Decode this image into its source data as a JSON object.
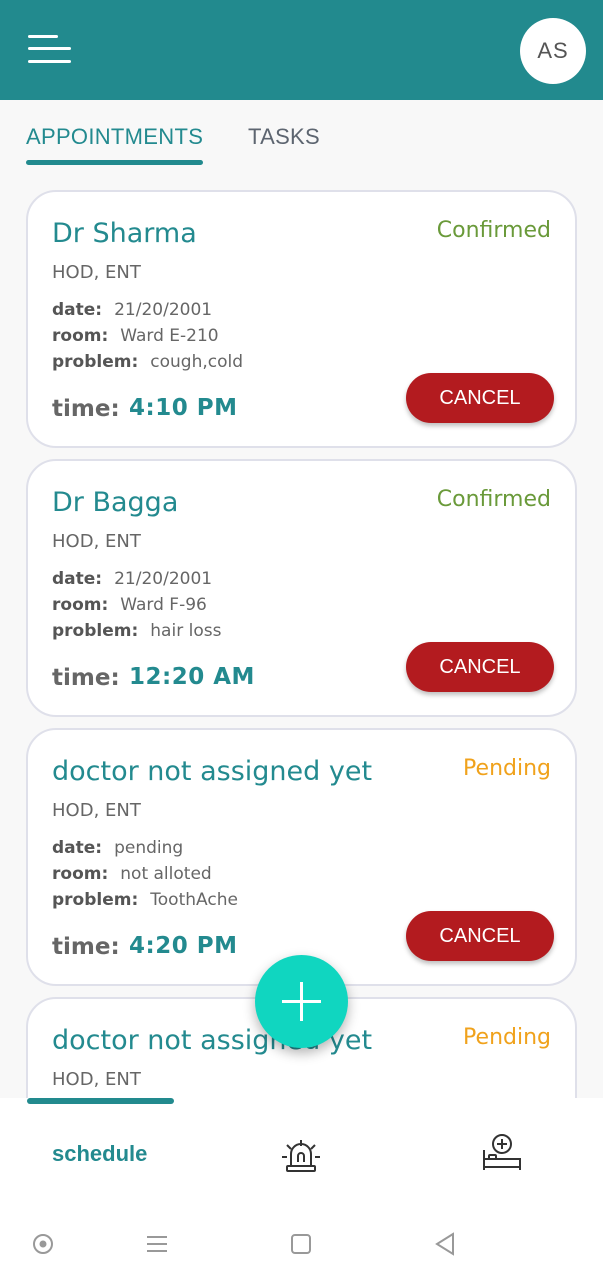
{
  "header": {
    "avatar_initials": "AS",
    "menu_icon": "hamburger-menu-icon"
  },
  "tabs": [
    {
      "label": "APPOINTMENTS",
      "active": true
    },
    {
      "label": "TASKS",
      "active": false
    }
  ],
  "appointments": [
    {
      "doctor": "Dr Sharma",
      "status": "Confirmed",
      "status_color": "#6a9a3a",
      "dept": "HOD, ENT",
      "date_label": "date:",
      "date": "21/20/2001",
      "room_label": "room:",
      "room": "Ward E-210",
      "problem_label": "problem:",
      "problem": "cough,cold",
      "time_label": "time:",
      "time": "4:10 PM",
      "cancel_label": "CANCEL"
    },
    {
      "doctor": "Dr Bagga",
      "status": "Confirmed",
      "status_color": "#6a9a3a",
      "dept": "HOD, ENT",
      "date_label": "date:",
      "date": "21/20/2001",
      "room_label": "room:",
      "room": "Ward F-96",
      "problem_label": "problem:",
      "problem": "hair loss",
      "time_label": "time:",
      "time": "12:20 AM",
      "cancel_label": "CANCEL"
    },
    {
      "doctor": "doctor not assigned yet",
      "status": "Pending",
      "status_color": "#f0a21c",
      "dept": "HOD, ENT",
      "date_label": "date:",
      "date": "pending",
      "room_label": "room:",
      "room": "not alloted",
      "problem_label": "problem:",
      "problem": "ToothAche",
      "time_label": "time:",
      "time": "4:20 PM",
      "cancel_label": "CANCEL"
    },
    {
      "doctor": "doctor not assigned yet",
      "status": "Pending",
      "status_color": "#f0a21c",
      "dept": "HOD, ENT"
    }
  ],
  "fab": {
    "icon": "plus-icon"
  },
  "bottom_nav": {
    "schedule_label": "schedule",
    "siren_icon": "siren-icon",
    "hospital_icon": "hospital-bed-icon"
  },
  "system_nav": [
    "home-circle-icon",
    "recents-menu-icon",
    "square-icon",
    "back-triangle-icon"
  ],
  "colors": {
    "primary": "#228a8e",
    "fab": "#10d6c0",
    "cancel": "#b31b1f",
    "confirmed": "#6a9a3a",
    "pending": "#f0a21c"
  }
}
